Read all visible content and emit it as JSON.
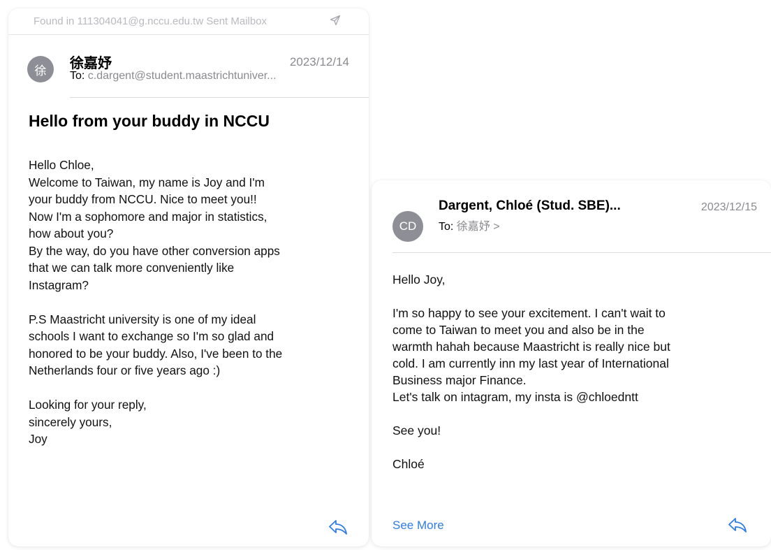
{
  "email1": {
    "found_in": "Found in 111304041@g.nccu.edu.tw Sent Mailbox",
    "avatar_initial": "徐",
    "sender": "徐嘉妤",
    "date": "2023/12/14",
    "to_label": "To:",
    "to_value": "c.dargent@student.maastrichtuniver...",
    "subject": "Hello from your buddy in NCCU",
    "body": [
      "Hello Chloe,\nWelcome to Taiwan, my name is Joy and I'm\nyour buddy from NCCU. Nice to meet you!!\nNow I'm a sophomore and major in statistics,\nhow about you?\nBy the way, do you have other conversion apps\nthat we can talk more conveniently like\nInstagram?",
      "P.S Maastricht university is one of my ideal\nschools I want to exchange so I'm so glad and\nhonored to be your buddy. Also, I've been to the\nNetherlands four or five years ago :)",
      "Looking for your reply,\nsincerely yours,\nJoy"
    ]
  },
  "email2": {
    "avatar_initial": "CD",
    "sender": "Dargent, Chloé (Stud. SBE)...",
    "date": "2023/12/15",
    "to_label": "To:",
    "to_value": "徐嘉妤 >",
    "body": [
      "Hello Joy,",
      "I'm so happy to see your excitement. I can't wait to\ncome to Taiwan to meet you and also be in the\nwarmth hahah because Maastricht is really nice but\ncold. I am currently inn my last year of International\nBusiness major Finance.\nLet's talk on intagram, my insta is @chloedntt",
      "See you!",
      "Chloé"
    ],
    "see_more": "See More"
  },
  "icons": {
    "sent": "paper-plane-icon",
    "reply": "reply-arrow-icon"
  },
  "colors": {
    "accent": "#2f7ce6",
    "avatar_bg": "#8e8e96",
    "secondary_text": "#8a8a8f"
  }
}
